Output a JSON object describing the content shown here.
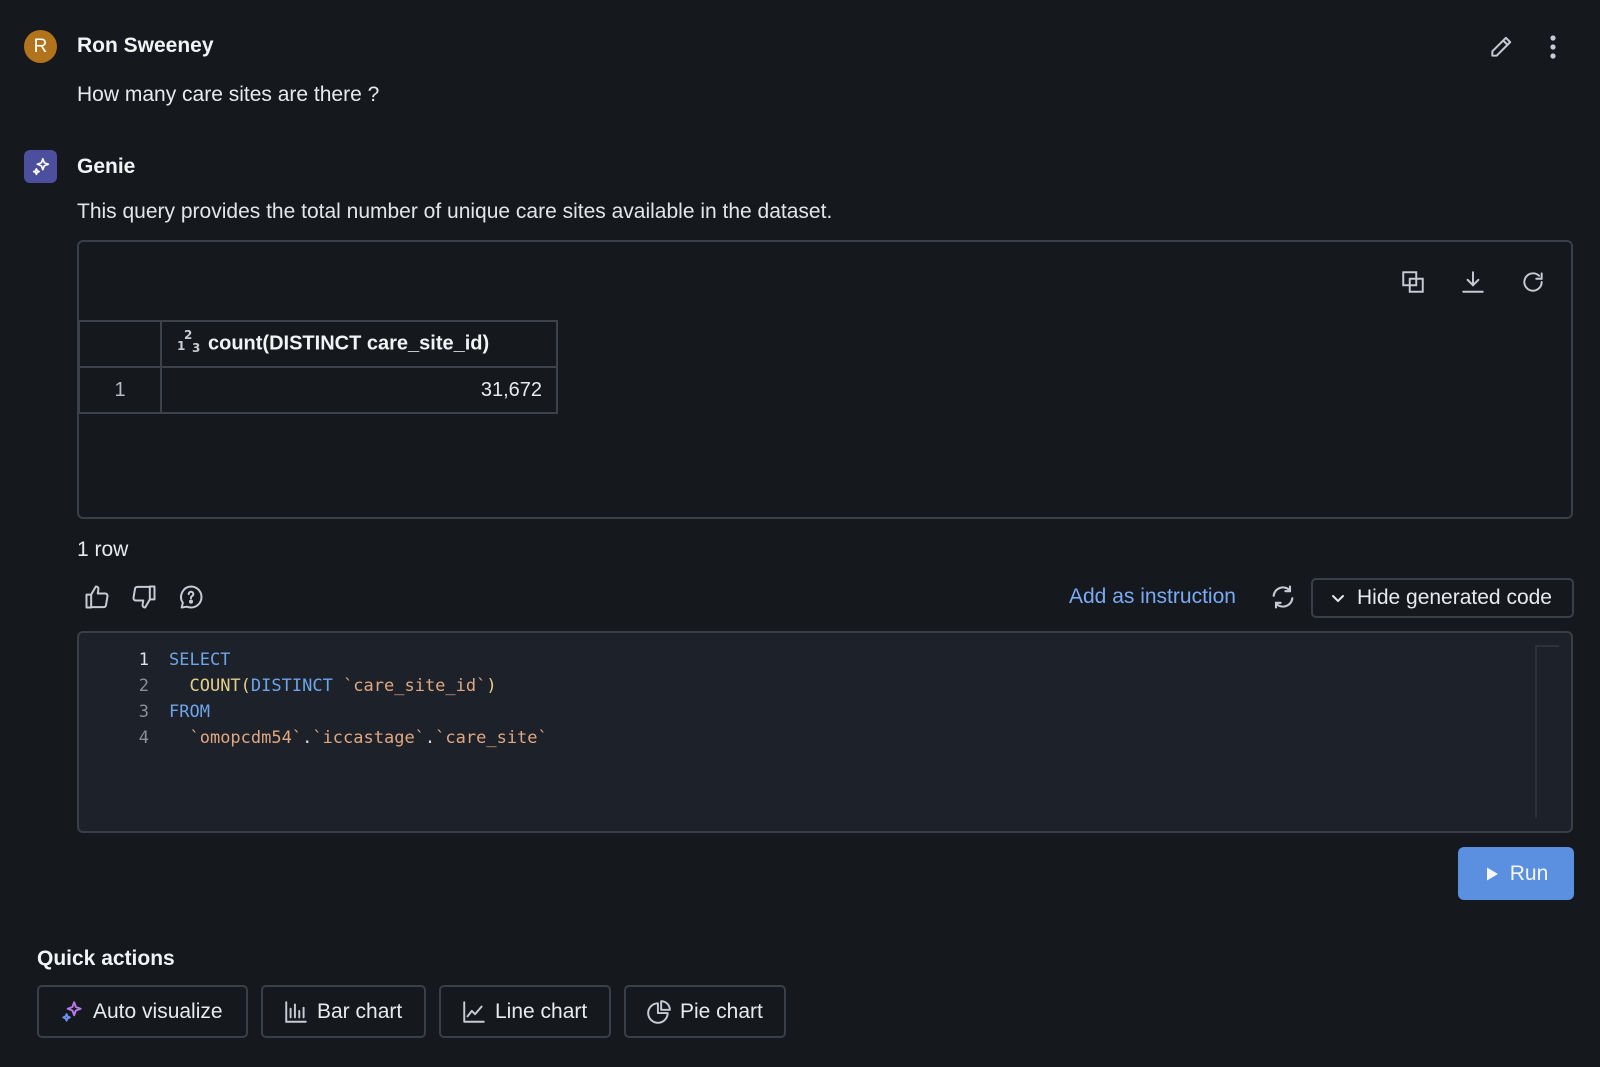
{
  "user_message": {
    "avatar_initial": "R",
    "name": "Ron Sweeney",
    "text": "How many care sites are there ?"
  },
  "genie": {
    "name": "Genie",
    "description": "This query provides the total number of unique care sites available in the dataset.",
    "result_table": {
      "columns": [
        "",
        "count(DISTINCT care_site_id)"
      ],
      "column_type_icon": "integer-type-icon",
      "rows": [
        {
          "index": "1",
          "value": "31,672"
        }
      ]
    },
    "row_count": "1 row",
    "add_instruction_label": "Add as instruction",
    "hide_code_label": "Hide generated code",
    "code_lines": [
      {
        "num": "1",
        "text": "SELECT"
      },
      {
        "num": "2",
        "text": "  COUNT(DISTINCT `care_site_id`)"
      },
      {
        "num": "3",
        "text": "FROM"
      },
      {
        "num": "4",
        "text": "  `omopcdm54`.`iccastage`.`care_site`"
      }
    ],
    "run_label": "Run"
  },
  "quick_actions": {
    "title": "Quick actions",
    "buttons": [
      {
        "label": "Auto visualize",
        "icon": "sparkle-icon"
      },
      {
        "label": "Bar chart",
        "icon": "bar-chart-icon"
      },
      {
        "label": "Line chart",
        "icon": "line-chart-icon"
      },
      {
        "label": "Pie chart",
        "icon": "pie-chart-icon"
      }
    ]
  },
  "colors": {
    "background": "#15181d",
    "accent": "#5b8fe0",
    "link": "#7aa9f5",
    "user_avatar": "#b1741c",
    "genie_avatar": "#4c4f9d"
  }
}
